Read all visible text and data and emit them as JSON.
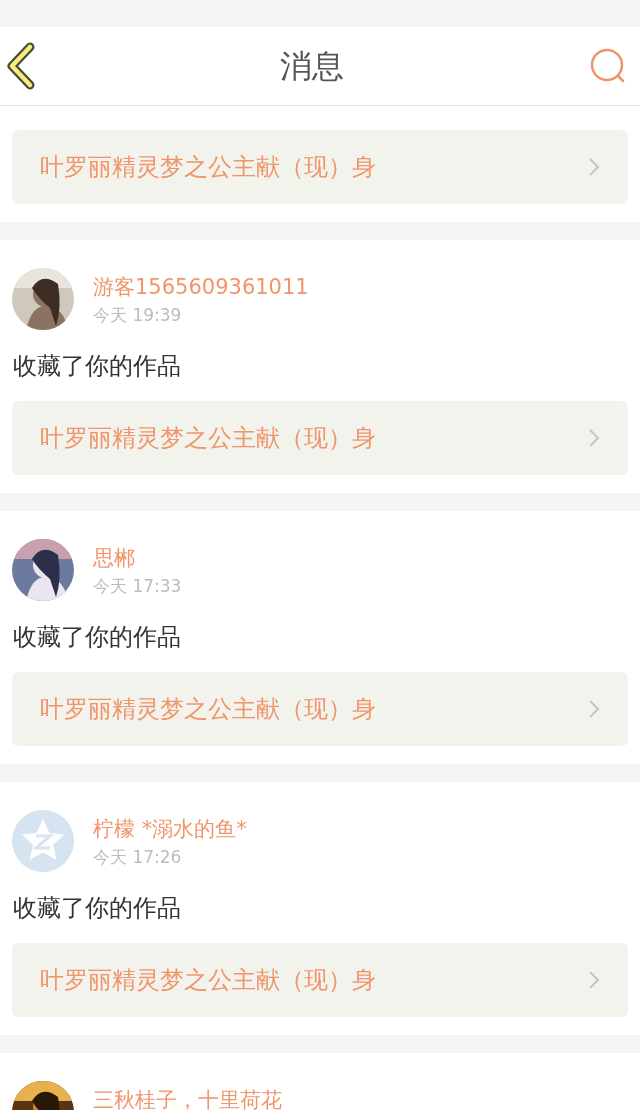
{
  "header": {
    "title": "消息"
  },
  "top_link": {
    "title": "叶罗丽精灵梦之公主献（现）身"
  },
  "messages": [
    {
      "name": "游客1565609361011",
      "time": "今天 19:39",
      "action": "收藏了你的作品",
      "link": "叶罗丽精灵梦之公主献（现）身"
    },
    {
      "name": "思郴",
      "time": "今天 17:33",
      "action": "收藏了你的作品",
      "link": "叶罗丽精灵梦之公主献（现）身"
    },
    {
      "avatar": {
        "kind": "default"
      },
      "name": "柠檬 *溺水的鱼*",
      "time": "今天 17:26",
      "action": "收藏了你的作品",
      "link": "叶罗丽精灵梦之公主献（现）身"
    },
    {
      "name": "三秋桂子，十里荷花"
    }
  ]
}
